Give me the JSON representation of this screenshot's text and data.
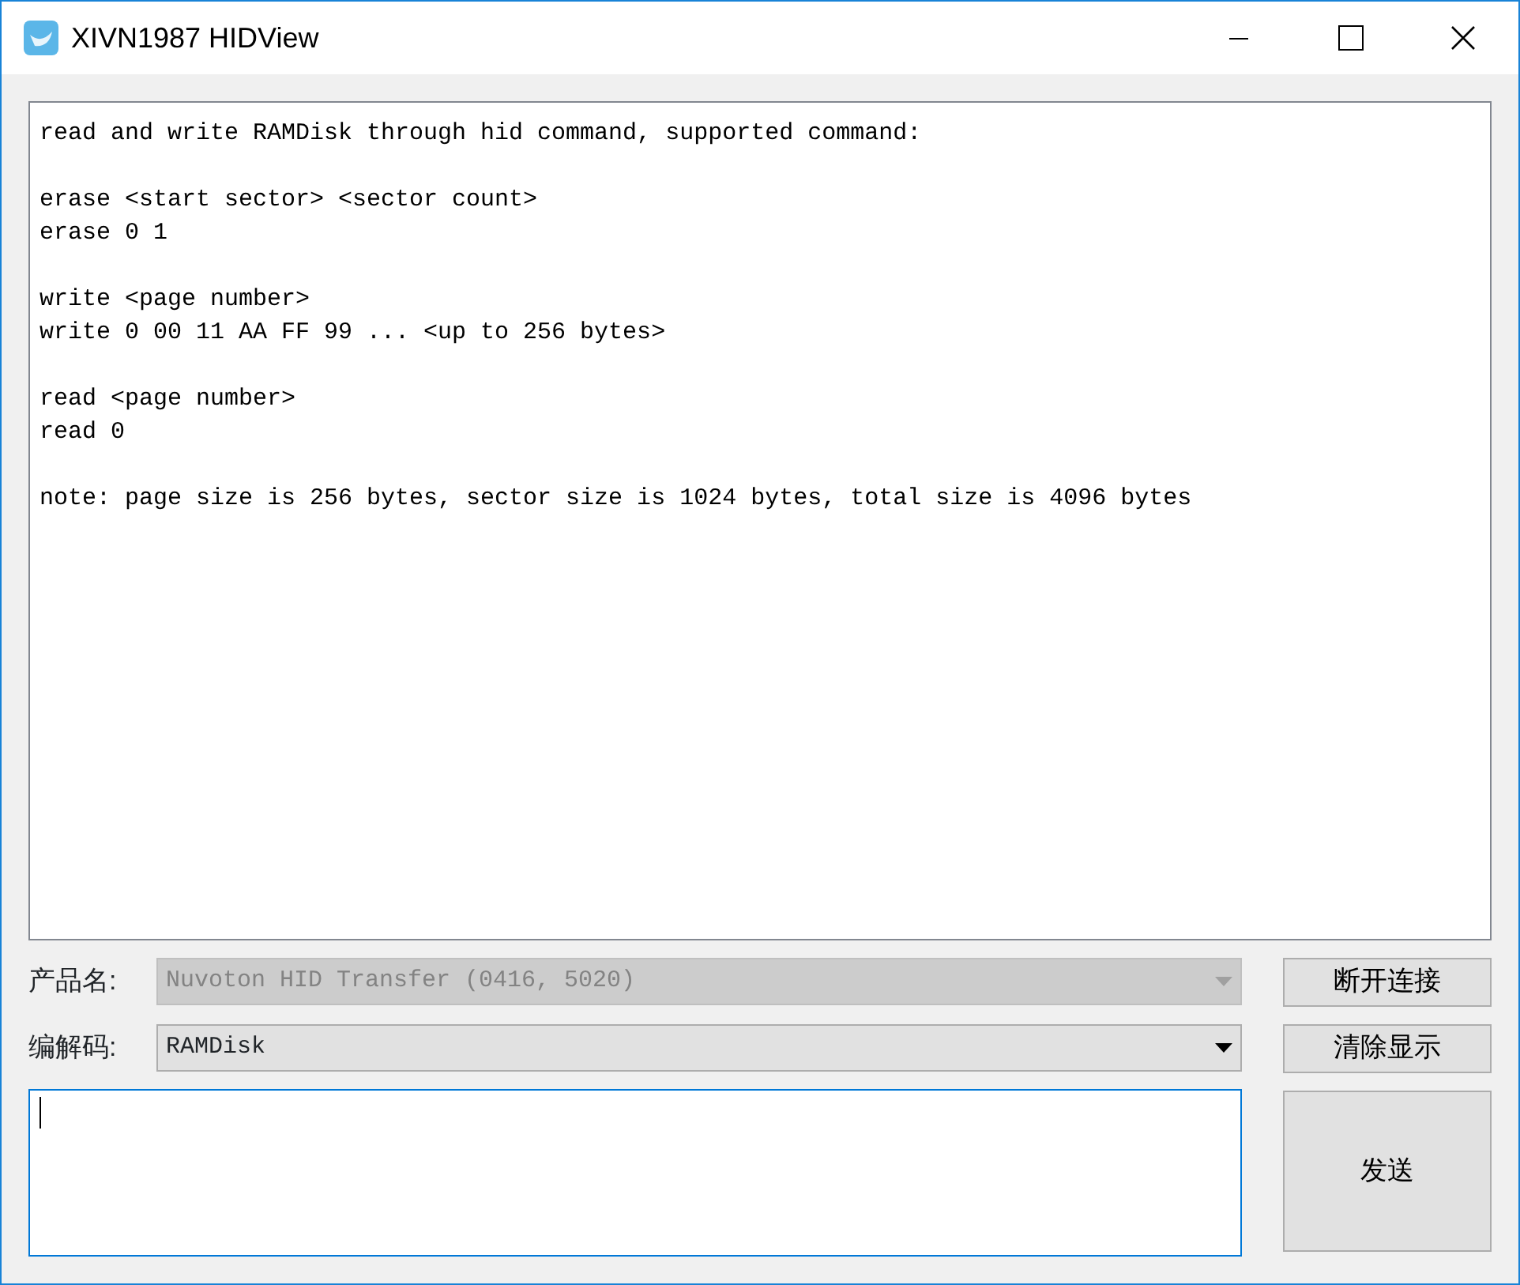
{
  "window": {
    "title": "XIVN1987 HIDView"
  },
  "output": {
    "blocks": [
      [
        "read and write RAMDisk through hid command, supported command:"
      ],
      [
        "erase <start sector> <sector count>",
        "erase 0 1"
      ],
      [
        "write <page number>",
        "write 0 00 11 AA FF 99 ... <up to 256 bytes>"
      ],
      [
        "read <page number>",
        "read 0"
      ],
      [
        "note: page size is 256 bytes, sector size is 1024 bytes, total size is 4096 bytes"
      ]
    ]
  },
  "fields": [
    {
      "label": "产品名:",
      "value": "Nuvoton HID Transfer (0416, 5020)",
      "disabled": true,
      "button": "断开连接"
    },
    {
      "label": "编解码:",
      "value": "RAMDisk",
      "disabled": false,
      "button": "清除显示"
    }
  ],
  "input": {
    "focused": true
  },
  "send_button": "发送"
}
